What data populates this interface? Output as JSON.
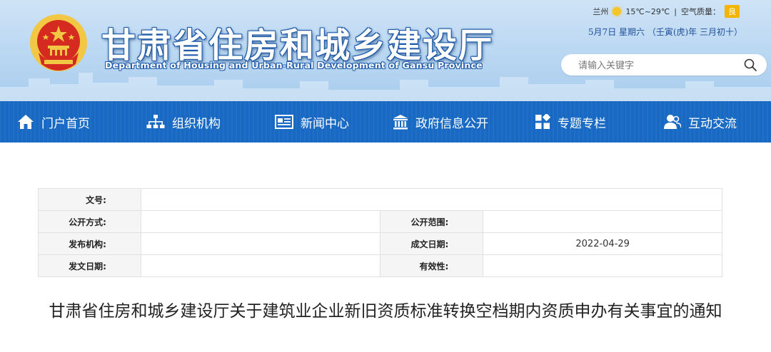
{
  "header": {
    "site_title": "甘肃省住房和城乡建设厅",
    "site_subtitle": "Department of Housing and Urban-Rural Development of Gansu Province",
    "weather": {
      "city": "兰州",
      "temperature": "15℃~29℃",
      "separator": "|",
      "air_quality_label": "空气质量：",
      "air_quality_value": "良",
      "icon": "sun-icon"
    },
    "date_line": "5月7日   星期六    （壬寅(虎)年 三月初十）",
    "search": {
      "placeholder": "请输入关键字",
      "icon": "search-icon"
    }
  },
  "nav": {
    "items": [
      {
        "label": "门户首页",
        "icon": "home-icon"
      },
      {
        "label": "组织机构",
        "icon": "org-chart-icon"
      },
      {
        "label": "新闻中心",
        "icon": "newspaper-icon"
      },
      {
        "label": "政府信息公开",
        "icon": "government-building-icon"
      },
      {
        "label": "专题专栏",
        "icon": "grid-tiles-icon"
      },
      {
        "label": "互动交流",
        "icon": "users-icon"
      }
    ]
  },
  "meta": {
    "doc_no_label": "文号:",
    "doc_no_value": "",
    "public_mode_label": "公开方式:",
    "public_mode_value": "",
    "public_scope_label": "公开范围:",
    "public_scope_value": "",
    "issuer_label": "发布机构:",
    "issuer_value": "",
    "created_date_label": "成文日期:",
    "created_date_value": "2022-04-29",
    "issue_date_label": "发文日期:",
    "issue_date_value": "",
    "validity_label": "有效性:",
    "validity_value": ""
  },
  "article": {
    "title": "甘肃省住房和城乡建设厅关于建筑业企业新旧资质标准转换空档期内资质申办有关事宜的通知"
  },
  "colors": {
    "nav_bg": "#1769c3",
    "header_bg": "#bcd8f2",
    "title_outline": "#1e5aa8",
    "emblem_red": "#d42a20",
    "emblem_gold": "#f2c744",
    "aq_badge": "#f4b400"
  }
}
